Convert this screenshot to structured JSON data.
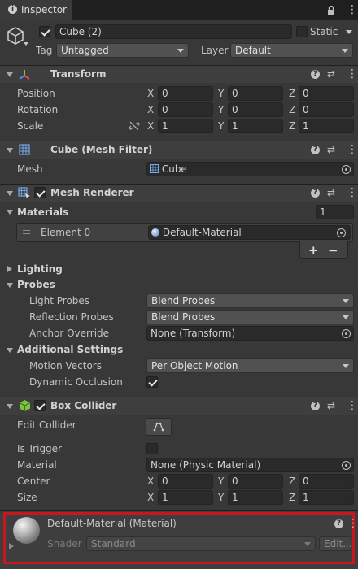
{
  "tab": {
    "title": "Inspector"
  },
  "object": {
    "name": "Cube (2)",
    "static_label": "Static",
    "tag_label": "Tag",
    "tag_value": "Untagged",
    "layer_label": "Layer",
    "layer_value": "Default"
  },
  "transform": {
    "title": "Transform",
    "position_label": "Position",
    "rotation_label": "Rotation",
    "scale_label": "Scale",
    "axis_x": "X",
    "axis_y": "Y",
    "axis_z": "Z",
    "position": [
      "0",
      "0",
      "0"
    ],
    "rotation": [
      "0",
      "0",
      "0"
    ],
    "scale": [
      "1",
      "1",
      "1"
    ]
  },
  "mesh_filter": {
    "title": "Cube (Mesh Filter)",
    "mesh_label": "Mesh",
    "mesh_value": "Cube"
  },
  "mesh_renderer": {
    "title": "Mesh Renderer",
    "materials_label": "Materials",
    "materials_count": "1",
    "element_label": "Element 0",
    "element_value": "Default-Material",
    "plus": "+",
    "minus": "−",
    "lighting_label": "Lighting",
    "probes_label": "Probes",
    "light_probes_label": "Light Probes",
    "light_probes_value": "Blend Probes",
    "reflection_probes_label": "Reflection Probes",
    "reflection_probes_value": "Blend Probes",
    "anchor_label": "Anchor Override",
    "anchor_value": "None (Transform)",
    "additional_label": "Additional Settings",
    "motion_label": "Motion Vectors",
    "motion_value": "Per Object Motion",
    "occlusion_label": "Dynamic Occlusion"
  },
  "box_collider": {
    "title": "Box Collider",
    "edit_label": "Edit Collider",
    "trigger_label": "Is Trigger",
    "material_label": "Material",
    "material_value": "None (Physic Material)",
    "center_label": "Center",
    "size_label": "Size",
    "center": [
      "0",
      "0",
      "0"
    ],
    "size": [
      "1",
      "1",
      "1"
    ]
  },
  "material": {
    "title": "Default-Material (Material)",
    "shader_label": "Shader",
    "shader_value": "Standard",
    "edit_label": "Edit..."
  },
  "colors": {
    "highlight": "#c8161d",
    "component_green": "#7dc242",
    "grid_blue": "#74a8e8"
  }
}
